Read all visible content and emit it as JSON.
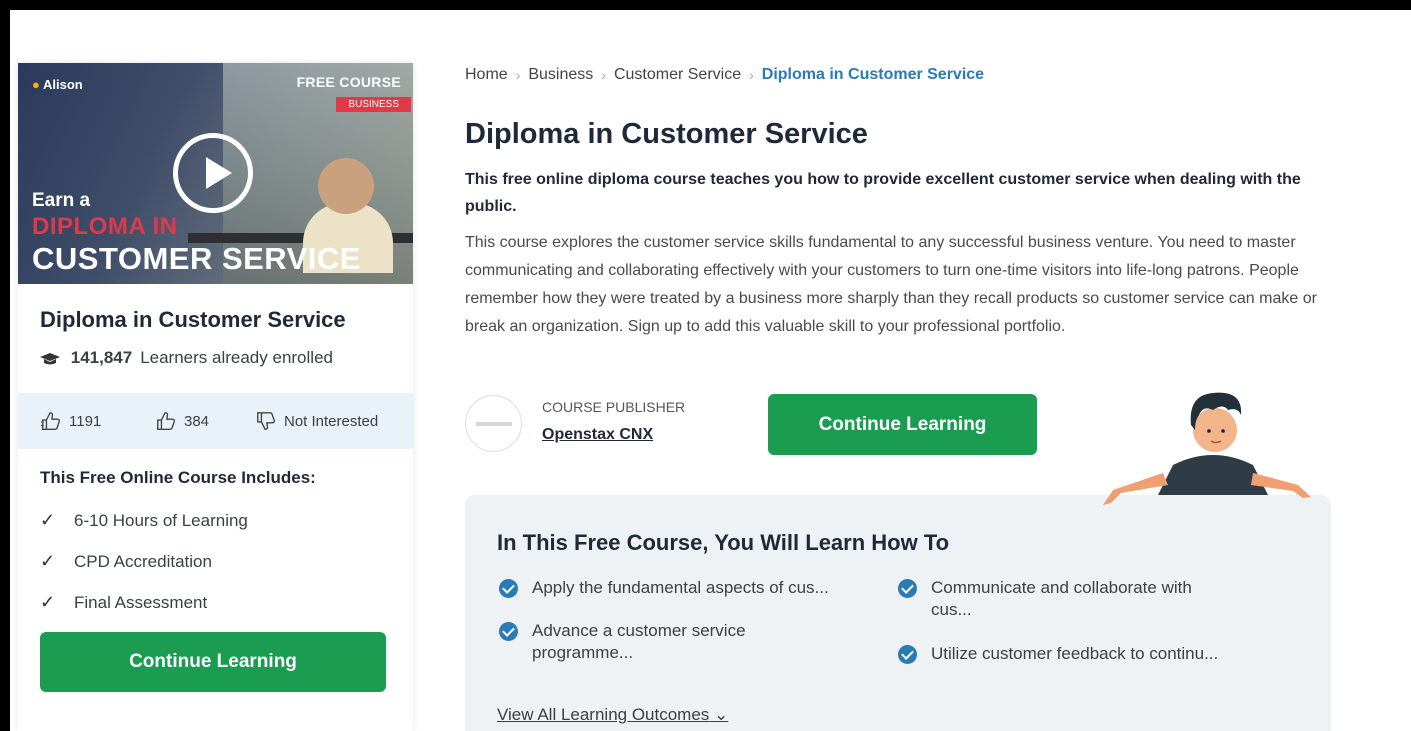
{
  "hero": {
    "logo": "Alison",
    "free_label": "FREE COURSE",
    "category_tag": "BUSINESS",
    "line1": "Earn a",
    "line2": "DIPLOMA IN",
    "line3": "CUSTOMER SERVICE"
  },
  "card": {
    "title": "Diploma in Customer Service",
    "learners_count": "141,847",
    "learners_text": "Learners already enrolled",
    "rating": {
      "likes": "1191",
      "thumbs_up": "384",
      "not_interested": "Not Interested"
    },
    "includes_title": "This Free Online Course Includes:",
    "includes": [
      "6-10 Hours of Learning",
      "CPD Accreditation",
      "Final Assessment"
    ],
    "cta": "Continue Learning"
  },
  "breadcrumb": [
    "Home",
    "Business",
    "Customer Service",
    "Diploma in Customer Service"
  ],
  "main": {
    "title": "Diploma in Customer Service",
    "lead": "This free online diploma course teaches you how to provide excellent customer service when dealing with the public.",
    "description": "This course explores the customer service skills fundamental to any successful business venture. You need to master communicating and collaborating effectively with your customers to turn one-time visitors into life-long patrons. People remember how they were treated by a business more sharply than they recall products so customer service can make or break an organization. Sign up to add this valuable skill to your professional portfolio.",
    "publisher_label": "COURSE PUBLISHER",
    "publisher_name": "Openstax CNX",
    "cta": "Continue Learning"
  },
  "outcomes": {
    "title": "In This Free Course, You Will Learn How To",
    "items": [
      "Apply the fundamental aspects of cus...",
      "Communicate and collaborate with cus...",
      "Advance a customer service programme...",
      "Utilize customer feedback to continu..."
    ],
    "view_all": "View All Learning Outcomes"
  },
  "colors": {
    "cta_green": "#1a9d51",
    "link_blue": "#2a7ab5",
    "accent_red": "#e0394a",
    "rating_bg": "#e8f2f8",
    "outcomes_bg": "#eef2f4"
  },
  "icons": [
    "play-icon",
    "graduation-cap-icon",
    "like-icon",
    "thumbs-up-icon",
    "thumbs-down-icon",
    "check-icon",
    "check-circle-icon",
    "chevron-down-icon"
  ]
}
